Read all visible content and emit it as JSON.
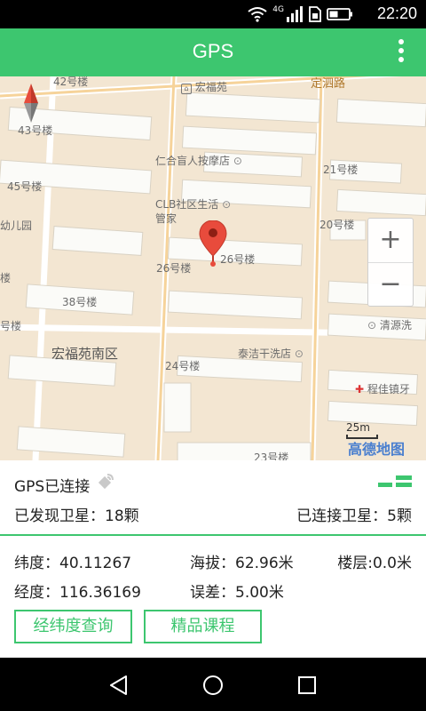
{
  "status_bar": {
    "time": "22:20",
    "network": "4G",
    "icons": [
      "wifi-icon",
      "signal-icon",
      "sim-icon",
      "battery-icon"
    ]
  },
  "app_bar": {
    "title": "GPS",
    "menu_icon": "overflow-menu-icon"
  },
  "map": {
    "labels": {
      "b42": "42号楼",
      "hongfuyuan": "宏福苑",
      "dingsi_road": "定泗路",
      "b43": "43号楼",
      "massage": "仁合盲人按摩店",
      "b21": "21号楼",
      "b45": "45号楼",
      "clb_line1": "CLB社区生活",
      "clb_line2": "管家",
      "kindergarten": "幼儿园",
      "b20": "20号楼",
      "b26_left": "26号楼",
      "b26_right": "26号楼",
      "lou_left1": "楼",
      "b38": "38号楼",
      "lou_left2": "号楼",
      "qingyuan": "清源洗",
      "hongfuyuan_south": "宏福苑南区",
      "taijie": "泰洁干洗店",
      "b24": "24号楼",
      "chengjiezhen": "程佳镇牙",
      "b23": "23号楼"
    },
    "zoom_in": "+",
    "zoom_out": "−",
    "scale_text": "25m",
    "brand": "高德地图",
    "accent": "#e84b3c"
  },
  "gps_panel": {
    "status": "GPS已连接",
    "satellites_found": "已发现卫星：18颗",
    "satellites_connected": "已连接卫星：5颗",
    "latitude": "纬度：40.11267",
    "altitude": "海拔：62.96米",
    "floor": "楼层:0.0米",
    "longitude": "经度：116.36169",
    "error": "误差：5.00米",
    "btn_query": "经纬度查询",
    "btn_course": "精品课程"
  },
  "colors": {
    "primary": "#3dc66f",
    "map_bg": "#f3e6d2",
    "marker": "#e84b3c"
  }
}
